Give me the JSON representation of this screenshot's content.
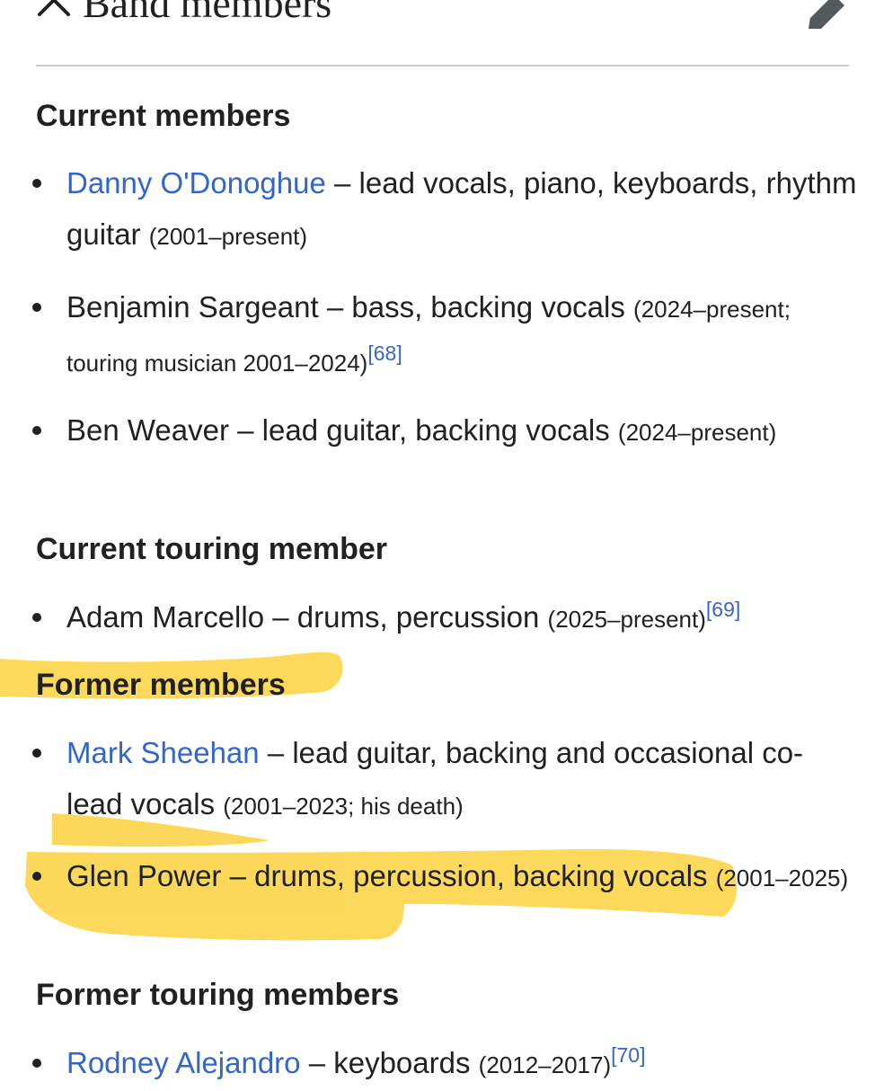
{
  "header": {
    "title": "Band members",
    "collapse_icon": "chevron-up-icon",
    "edit_icon": "pencil-icon"
  },
  "highlight_color": "#fbd23e",
  "link_color": "#3366cc",
  "sections": {
    "current": {
      "heading": "Current members",
      "items": [
        {
          "name": "Danny O'Donoghue",
          "role": " – lead vocals, piano, keyboards, rhythm guitar ",
          "years": "(2001–present)"
        },
        {
          "name": "Benjamin Sargeant",
          "role": " – bass, backing vocals ",
          "years": "(2024–present; touring musician 2001–2024)",
          "ref": "[68]"
        },
        {
          "name": "Ben Weaver",
          "role": " – lead guitar, backing vocals ",
          "years": "(2024–present)"
        }
      ]
    },
    "current_touring": {
      "heading": "Current touring member",
      "items": [
        {
          "name": "Adam Marcello",
          "role": " – drums, percussion ",
          "years": "(2025–present)",
          "ref": "[69]"
        }
      ]
    },
    "former": {
      "heading": "Former members",
      "items": [
        {
          "name": "Mark Sheehan",
          "role": " – lead guitar, backing and occasional co-lead vocals ",
          "years": "(2001–2023; his death)"
        },
        {
          "name": "Glen Power",
          "role": " – drums, percussion, backing vocals ",
          "years": "(2001–2025)"
        }
      ]
    },
    "former_touring": {
      "heading": "Former touring members",
      "items": [
        {
          "name": "Rodney Alejandro",
          "role": " – keyboards ",
          "years": "(2012–2017)",
          "ref": "[70]"
        }
      ]
    }
  }
}
